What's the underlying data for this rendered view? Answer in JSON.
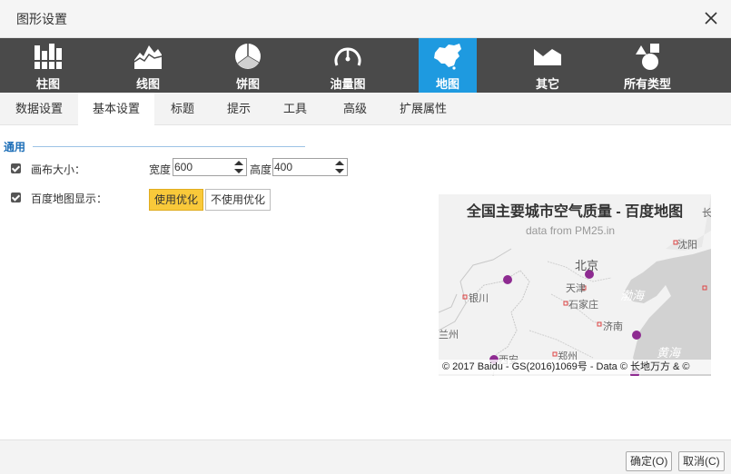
{
  "dialog": {
    "title": "图形设置"
  },
  "chart_types": [
    {
      "label": "柱图",
      "icon": "bar-chart-icon"
    },
    {
      "label": "线图",
      "icon": "area-chart-icon"
    },
    {
      "label": "饼图",
      "icon": "pie-chart-icon"
    },
    {
      "label": "油量图",
      "icon": "gauge-icon"
    },
    {
      "label": "地图",
      "icon": "china-map-icon",
      "active": true
    },
    {
      "label": "其它",
      "icon": "other-chart-icon"
    },
    {
      "label": "所有类型",
      "icon": "all-types-icon"
    }
  ],
  "tabs": [
    {
      "label": "数据设置"
    },
    {
      "label": "基本设置",
      "active": true
    },
    {
      "label": "标题"
    },
    {
      "label": "提示"
    },
    {
      "label": "工具"
    },
    {
      "label": "高级"
    },
    {
      "label": "扩展属性"
    }
  ],
  "general": {
    "section_title": "通用",
    "canvas_size_label": "画布大小：",
    "width_label": "宽度",
    "width_value": "600",
    "height_label": "高度",
    "height_value": "400",
    "baidu_map_label": "百度地图显示：",
    "optimize_on": "使用优化",
    "optimize_off": "不使用优化"
  },
  "preview": {
    "title": "全国主要城市空气质量 - 百度地图",
    "subtitle": "data from PM25.in",
    "cities": {
      "beijing": "北京",
      "tianjin": "天津",
      "shijiazhuang": "石家庄",
      "jinan": "济南",
      "zhengzhou": "郑州",
      "yinchuan": "银川",
      "shenyang": "沈阳",
      "lanzhou": "兰州",
      "xian": "西安",
      "changchun": "长"
    },
    "seas": {
      "bohai": "渤海",
      "huanghai": "黄海"
    },
    "copyright": "© 2017 Baidu - GS(2016)1069号 - Data © 长地万方 & ©",
    "point_color": "#8e2b91"
  },
  "footer": {
    "ok": "确定(O)",
    "cancel": "取消(C)"
  },
  "colors": {
    "accent": "#1e9ae0",
    "toolbar": "#4a4a4a",
    "active_option": "#f9c93a"
  }
}
